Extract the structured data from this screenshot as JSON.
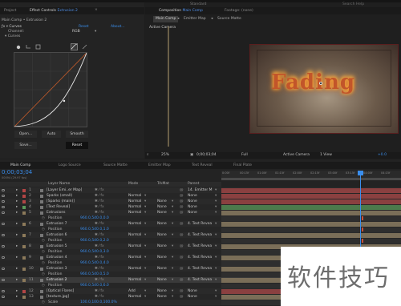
{
  "top": {
    "left_tabs": [
      "Project",
      "Effect Controls",
      "Extrusion 2"
    ],
    "center_tabs": [
      "Composition",
      "Main Comp",
      "Footage: (none)"
    ],
    "workspace": "Standard",
    "right_title": "Search Help"
  },
  "effect_controls": {
    "breadcrumb": "Main Comp • Extrusion 2",
    "fx_name": "Curves",
    "reset_link": "Reset",
    "about_link": "About...",
    "channel_label": "Channel:",
    "channel_value": "RGB",
    "curves_label": "Curves",
    "buttons": {
      "open": "Open...",
      "auto": "Auto",
      "smooth": "Smooth",
      "save": "Save...",
      "reset": "Reset"
    }
  },
  "composition": {
    "sub_tabs": [
      "Main Comp",
      "Emitter Map",
      "Source Matte"
    ],
    "camera_label": "Active Camera",
    "preview_text": "Fading",
    "footer": {
      "zoom": "25%",
      "timecode": "0;00;03;04",
      "resolution": "Full",
      "camera": "Active Camera",
      "views": "1 View",
      "plus": "+0.0"
    }
  },
  "timeline": {
    "tabs": [
      "Main Comp",
      "Logo Source",
      "Source Matte",
      "Emitter Map",
      "Text Reveal",
      "Final Plate"
    ],
    "timecode": "0;00;03;04",
    "fps": "00094 (29.97 fps)",
    "headers": {
      "layer_name": "Layer Name",
      "mode": "Mode",
      "trkmat": "TrkMat",
      "parent": "Parent"
    },
    "ruler": [
      "0:00f",
      "00:15f",
      "01:00f",
      "01:15f",
      "02:00f",
      "02:15f",
      "03:00f",
      "03:15f",
      "04:00f",
      "04:15f"
    ],
    "rows": [
      {
        "num": "1",
        "name": "[Layer Emi..er Map]",
        "mode": "",
        "trk": "",
        "parent": "14. Emitter M",
        "color": "#b34545",
        "sub": false
      },
      {
        "num": "2",
        "name": "Sparks (small)",
        "mode": "Normal",
        "trk": "",
        "parent": "None",
        "color": "#b34545",
        "sub": false
      },
      {
        "num": "3",
        "name": "[Sparks (main)]",
        "mode": "Normal",
        "trk": "None",
        "parent": "None",
        "color": "#b34545",
        "sub": false
      },
      {
        "num": "4",
        "name": "[Text Reveal]",
        "mode": "Normal",
        "trk": "None",
        "parent": "None",
        "color": "#5a9a5a",
        "sub": false
      },
      {
        "num": "5",
        "name": "Extrusions",
        "mode": "Normal",
        "trk": "None",
        "parent": "None",
        "color": "#8c7a5a",
        "sub": false
      },
      {
        "num": "",
        "name": "Position",
        "mode": "",
        "trk": "",
        "parent": "",
        "value": "960.0,540.0,0.0",
        "sub": true
      },
      {
        "num": "6",
        "name": "Extrusion 7",
        "mode": "Normal",
        "trk": "None",
        "parent": "4. Text Revea",
        "color": "#8c7a5a",
        "sub": false
      },
      {
        "num": "",
        "name": "Position",
        "mode": "",
        "trk": "",
        "parent": "",
        "value": "960.0,540.0,1.0",
        "sub": true
      },
      {
        "num": "7",
        "name": "Extrusion 6",
        "mode": "Normal",
        "trk": "None",
        "parent": "4. Text Revea",
        "color": "#8c7a5a",
        "sub": false
      },
      {
        "num": "",
        "name": "Position",
        "mode": "",
        "trk": "",
        "parent": "",
        "value": "960.0,540.0,2.0",
        "sub": true
      },
      {
        "num": "8",
        "name": "Extrusion 5",
        "mode": "Normal",
        "trk": "None",
        "parent": "4. Text Revea",
        "color": "#8c7a5a",
        "sub": false
      },
      {
        "num": "",
        "name": "Position",
        "mode": "",
        "trk": "",
        "parent": "",
        "value": "960.0,540.0,3.0",
        "sub": true
      },
      {
        "num": "9",
        "name": "Extrusion 4",
        "mode": "Normal",
        "trk": "None",
        "parent": "4. Text Revea",
        "color": "#8c7a5a",
        "sub": false
      },
      {
        "num": "",
        "name": "Position",
        "mode": "",
        "trk": "",
        "parent": "",
        "value": "960.0,540.0,4.0",
        "sub": true
      },
      {
        "num": "10",
        "name": "Extrusion 3",
        "mode": "Normal",
        "trk": "None",
        "parent": "4. Text Revea",
        "color": "#8c7a5a",
        "sub": false
      },
      {
        "num": "",
        "name": "Position",
        "mode": "",
        "trk": "",
        "parent": "",
        "value": "960.0,540.0,5.0",
        "sub": true
      },
      {
        "num": "11",
        "name": "Extrusion 2",
        "mode": "Normal",
        "trk": "None",
        "parent": "4. Text Revea",
        "color": "#8c7a5a",
        "sub": false,
        "selected": true
      },
      {
        "num": "",
        "name": "Position",
        "mode": "",
        "trk": "",
        "parent": "",
        "value": "960.0,540.0,6.0",
        "sub": true
      },
      {
        "num": "12",
        "name": "[Optical Flares]",
        "mode": "Add",
        "trk": "None",
        "parent": "None",
        "color": "#b34545",
        "sub": false
      },
      {
        "num": "13",
        "name": "[texture.jpg]",
        "mode": "Normal",
        "trk": "None",
        "parent": "None",
        "color": "#8c7a5a",
        "sub": false
      },
      {
        "num": "",
        "name": "Scale",
        "mode": "",
        "trk": "",
        "parent": "",
        "value": "100.0,100.0,100.0%",
        "sub": true
      }
    ]
  },
  "watermark": "软件技巧"
}
